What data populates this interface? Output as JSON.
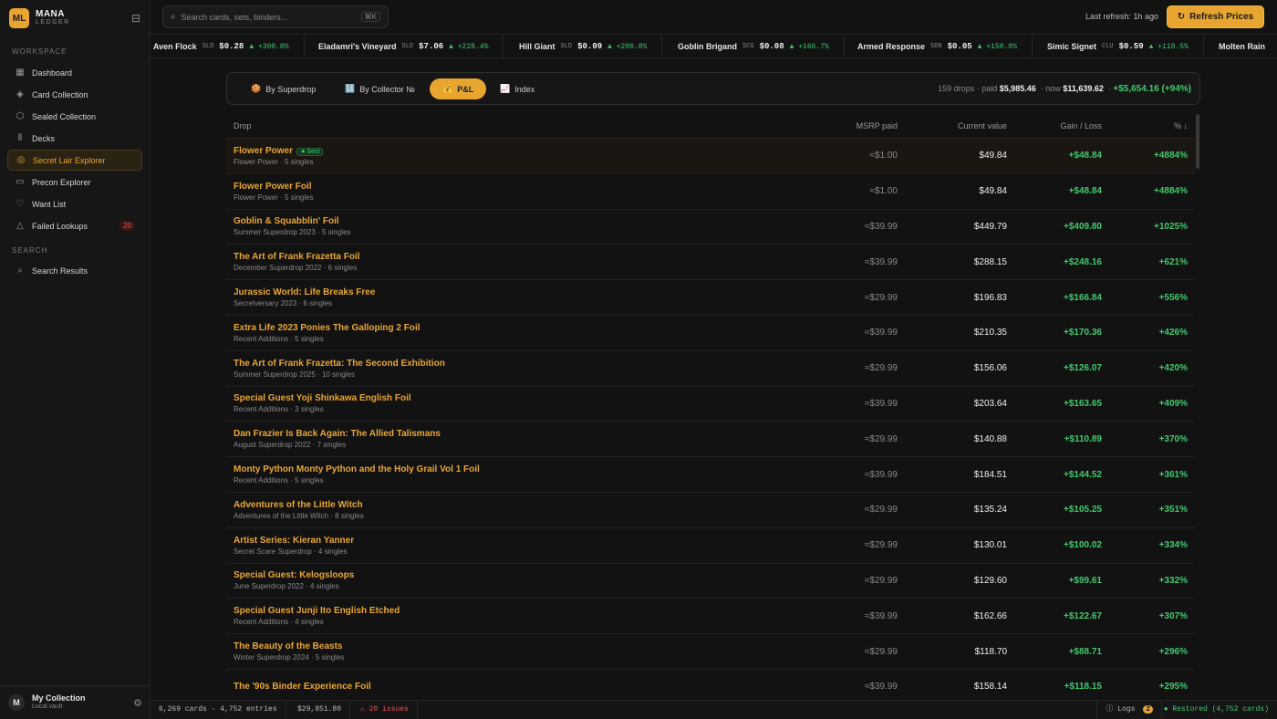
{
  "brand": {
    "logo": "ML",
    "name": "MANA",
    "sub": "LEDGER"
  },
  "sidebar": {
    "workspace_label": "WORKSPACE",
    "search_label": "SEARCH",
    "items": [
      {
        "label": "Dashboard",
        "icon": "dashboard-icon"
      },
      {
        "label": "Card Collection",
        "icon": "layers-icon"
      },
      {
        "label": "Sealed Collection",
        "icon": "box-icon"
      },
      {
        "label": "Decks",
        "icon": "library-icon"
      },
      {
        "label": "Secret Lair Explorer",
        "icon": "compass-icon"
      },
      {
        "label": "Precon Explorer",
        "icon": "folder-icon"
      },
      {
        "label": "Want List",
        "icon": "heart-icon"
      },
      {
        "label": "Failed Lookups",
        "icon": "warning-icon",
        "badge": "20"
      }
    ],
    "search_items": [
      {
        "label": "Search Results",
        "icon": "search-icon"
      }
    ],
    "footer": {
      "avatar": "M",
      "name": "My Collection",
      "sub": "Local vault"
    }
  },
  "topbar": {
    "search_placeholder": "Search cards, sets, binders...",
    "shortcut": "⌘K",
    "last_refresh": "Last refresh: 1h ago",
    "refresh_label": "Refresh Prices"
  },
  "ticker": [
    {
      "name": "Aven Flock",
      "code": "SLD",
      "price": "$0.28",
      "change": "▲ +300.0%"
    },
    {
      "name": "Eladamri's Vineyard",
      "code": "SLD",
      "price": "$7.06",
      "change": "▲ +228.4%"
    },
    {
      "name": "Hill Giant",
      "code": "SLD",
      "price": "$0.09",
      "change": "▲ +200.0%"
    },
    {
      "name": "Goblin Brigand",
      "code": "SCG",
      "price": "$0.08",
      "change": "▲ +166.7%"
    },
    {
      "name": "Armed Response",
      "code": "5DN",
      "price": "$0.05",
      "change": "▲ +150.0%"
    },
    {
      "name": "Simic Signet",
      "code": "CLU",
      "price": "$0.59",
      "change": "▲ +118.5%"
    },
    {
      "name": "Molten Rain",
      "code": "",
      "price": "",
      "change": ""
    }
  ],
  "tabs": [
    {
      "label": "By Superdrop",
      "icon": "🍪"
    },
    {
      "label": "By Collector №",
      "icon": "🔢"
    },
    {
      "label": "P&L",
      "icon": "💰"
    },
    {
      "label": "Index",
      "icon": "📈"
    }
  ],
  "summary": {
    "drops": "159 drops · paid",
    "paid": "$5,985.46",
    "now_label": "now",
    "now": "$11,639.62",
    "gain": "+$5,654.16 (+94%)"
  },
  "table": {
    "headers": {
      "drop": "Drop",
      "msrp": "MSRP paid",
      "current": "Current value",
      "gain": "Gain / Loss",
      "pct": "% ↓"
    },
    "rows": [
      {
        "name": "Flower Power",
        "badge": "★ best",
        "sub": "Flower Power · 5 singles",
        "msrp": "≈$1.00",
        "current": "$49.84",
        "gain": "+$48.84",
        "pct": "+4884%"
      },
      {
        "name": "Flower Power Foil",
        "sub": "Flower Power · 5 singles",
        "msrp": "≈$1.00",
        "current": "$49.84",
        "gain": "+$48.84",
        "pct": "+4884%"
      },
      {
        "name": "Goblin & Squabblin' Foil",
        "sub": "Summer Superdrop 2023 · 5 singles",
        "msrp": "≈$39.99",
        "current": "$449.79",
        "gain": "+$409.80",
        "pct": "+1025%"
      },
      {
        "name": "The Art of Frank Frazetta Foil",
        "sub": "December Superdrop 2022 · 6 singles",
        "msrp": "≈$39.99",
        "current": "$288.15",
        "gain": "+$248.16",
        "pct": "+621%"
      },
      {
        "name": "Jurassic World: Life Breaks Free",
        "sub": "Secretversary 2023 · 6 singles",
        "msrp": "≈$29.99",
        "current": "$196.83",
        "gain": "+$166.84",
        "pct": "+556%"
      },
      {
        "name": "Extra Life 2023 Ponies The Galloping 2 Foil",
        "sub": "Recent Additions · 5 singles",
        "msrp": "≈$39.99",
        "current": "$210.35",
        "gain": "+$170.36",
        "pct": "+426%"
      },
      {
        "name": "The Art of Frank Frazetta: The Second Exhibition",
        "sub": "Summer Superdrop 2025 · 10 singles",
        "msrp": "≈$29.99",
        "current": "$156.06",
        "gain": "+$126.07",
        "pct": "+420%"
      },
      {
        "name": "Special Guest Yoji Shinkawa English Foil",
        "sub": "Recent Additions · 3 singles",
        "msrp": "≈$39.99",
        "current": "$203.64",
        "gain": "+$163.65",
        "pct": "+409%"
      },
      {
        "name": "Dan Frazier Is Back Again: The Allied Talismans",
        "sub": "August Superdrop 2022 · 7 singles",
        "msrp": "≈$29.99",
        "current": "$140.88",
        "gain": "+$110.89",
        "pct": "+370%"
      },
      {
        "name": "Monty Python Monty Python and the Holy Grail Vol 1 Foil",
        "sub": "Recent Additions · 5 singles",
        "msrp": "≈$39.99",
        "current": "$184.51",
        "gain": "+$144.52",
        "pct": "+361%"
      },
      {
        "name": "Adventures of the Little Witch",
        "sub": "Adventures of the Little Witch · 8 singles",
        "msrp": "≈$29.99",
        "current": "$135.24",
        "gain": "+$105.25",
        "pct": "+351%"
      },
      {
        "name": "Artist Series: Kieran Yanner",
        "sub": "Secret Scare Superdrop · 4 singles",
        "msrp": "≈$29.99",
        "current": "$130.01",
        "gain": "+$100.02",
        "pct": "+334%"
      },
      {
        "name": "Special Guest: Kelogsloops",
        "sub": "June Superdrop 2022 · 4 singles",
        "msrp": "≈$29.99",
        "current": "$129.60",
        "gain": "+$99.61",
        "pct": "+332%"
      },
      {
        "name": "Special Guest Junji Ito English Etched",
        "sub": "Recent Additions · 4 singles",
        "msrp": "≈$39.99",
        "current": "$162.66",
        "gain": "+$122.67",
        "pct": "+307%"
      },
      {
        "name": "The Beauty of the Beasts",
        "sub": "Winter Superdrop 2024 · 5 singles",
        "msrp": "≈$29.99",
        "current": "$118.70",
        "gain": "+$88.71",
        "pct": "+296%"
      },
      {
        "name": "The '90s Binder Experience Foil",
        "sub": "",
        "msrp": "≈$39.99",
        "current": "$158.14",
        "gain": "+$118.15",
        "pct": "+295%"
      }
    ]
  },
  "statusbar": {
    "counts": "6,269 cards · 4,752 entries",
    "value": "$29,851.80",
    "issues": "⚠ 20 issues",
    "logs": "Logs",
    "logs_count": "2",
    "restored": "● Restored (4,752 cards)"
  },
  "colors": {
    "accent": "#e8a630",
    "positive": "#3fca6b",
    "danger": "#e05454",
    "background": "#121212"
  }
}
